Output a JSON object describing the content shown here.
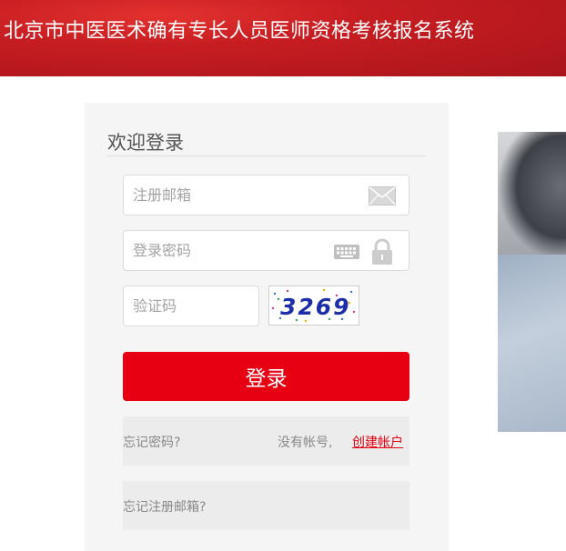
{
  "header": {
    "title": "北京市中医医术确有专长人员医师资格考核报名系统"
  },
  "login": {
    "title": "欢迎登录",
    "email_placeholder": "注册邮箱",
    "password_placeholder": "登录密码",
    "captcha_placeholder": "验证码",
    "captcha_text": "3269",
    "submit_label": "登录",
    "forgot_password": "忘记密码?",
    "no_account": "没有帐号,",
    "create_account": "创建帐户",
    "forgot_email": "忘记注册邮箱?"
  },
  "colors": {
    "brand_red": "#e60012",
    "header_red": "#b3161c"
  },
  "icons": {
    "email": "mail-icon",
    "keyboard": "keyboard-icon",
    "lock": "lock-icon"
  }
}
